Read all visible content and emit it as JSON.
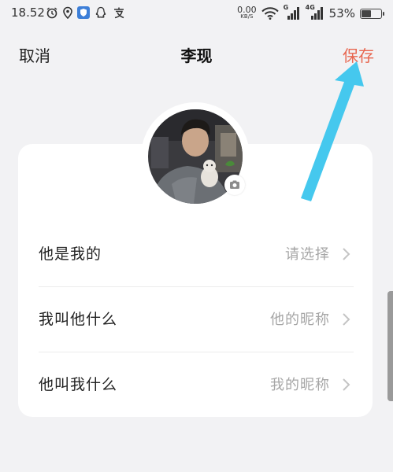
{
  "status_bar": {
    "time": "18.52",
    "net_speed_value": "0.00",
    "net_speed_unit": "KB/S",
    "signal_1_label": "G",
    "signal_2_label": "4G",
    "battery_percent_text": "53%",
    "battery_level": 0.53,
    "icons": [
      "alarm-icon",
      "location-icon",
      "shield-app-icon",
      "qq-icon",
      "alipay-icon",
      "wifi-icon",
      "signal-icon",
      "signal-icon",
      "battery-icon"
    ]
  },
  "nav": {
    "cancel_label": "取消",
    "title": "李现",
    "save_label": "保存"
  },
  "avatar": {
    "camera_icon": "camera-icon"
  },
  "rows": [
    {
      "label": "他是我的",
      "value": "请选择"
    },
    {
      "label": "我叫他什么",
      "value": "他的昵称"
    },
    {
      "label": "他叫我什么",
      "value": "我的昵称"
    }
  ],
  "colors": {
    "background": "#f2f2f4",
    "card": "#ffffff",
    "accent_save": "#e8664f",
    "annotation_arrow": "#45c8ee",
    "placeholder_text": "#a6a6a6"
  }
}
